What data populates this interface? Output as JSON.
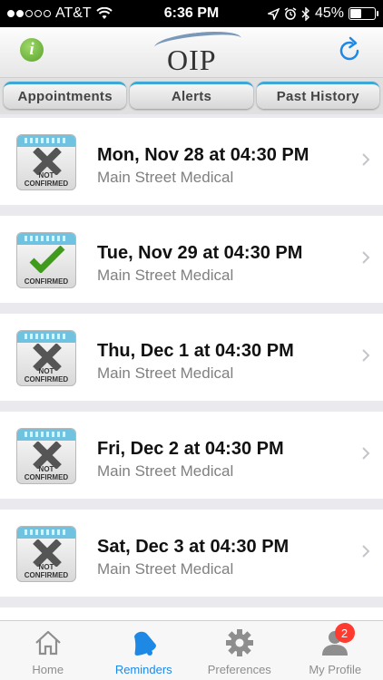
{
  "status_bar": {
    "carrier": "AT&T",
    "time": "6:36 PM",
    "battery": "45%",
    "battery_level": 0.45,
    "signal_bars": 2
  },
  "header": {
    "logo_text": "OIP",
    "info_glyph": "i"
  },
  "tabs": [
    {
      "label": "Appointments"
    },
    {
      "label": "Alerts"
    },
    {
      "label": "Past History"
    }
  ],
  "appointments": [
    {
      "title": "Mon, Nov 28 at 04:30 PM",
      "location": "Main Street Medical",
      "status": [
        "NOT",
        "CONFIRMED"
      ]
    },
    {
      "title": "Tue, Nov 29 at 04:30 PM",
      "location": "Main Street Medical",
      "status": [
        "CONFIRMED"
      ]
    },
    {
      "title": "Thu, Dec 1 at 04:30 PM",
      "location": "Main Street Medical",
      "status": [
        "NOT",
        "CONFIRMED"
      ]
    },
    {
      "title": "Fri, Dec 2 at 04:30 PM",
      "location": "Main Street Medical",
      "status": [
        "NOT",
        "CONFIRMED"
      ]
    },
    {
      "title": "Sat, Dec 3 at 04:30 PM",
      "location": "Main Street Medical",
      "status": [
        "NOT",
        "CONFIRMED"
      ]
    }
  ],
  "tab_bar": {
    "items": [
      {
        "label": "Home",
        "icon": "home-icon"
      },
      {
        "label": "Reminders",
        "icon": "bell-icon",
        "active": true
      },
      {
        "label": "Preferences",
        "icon": "gear-icon"
      },
      {
        "label": "My Profile",
        "icon": "person-icon",
        "badge": "2"
      }
    ]
  },
  "colors": {
    "accent_blue": "#1e88e5",
    "confirmed_green": "#3f9a1e",
    "not_confirmed_gray": "#555555",
    "badge_red": "#ff3b30",
    "tab_border": "#3fa7d6"
  }
}
